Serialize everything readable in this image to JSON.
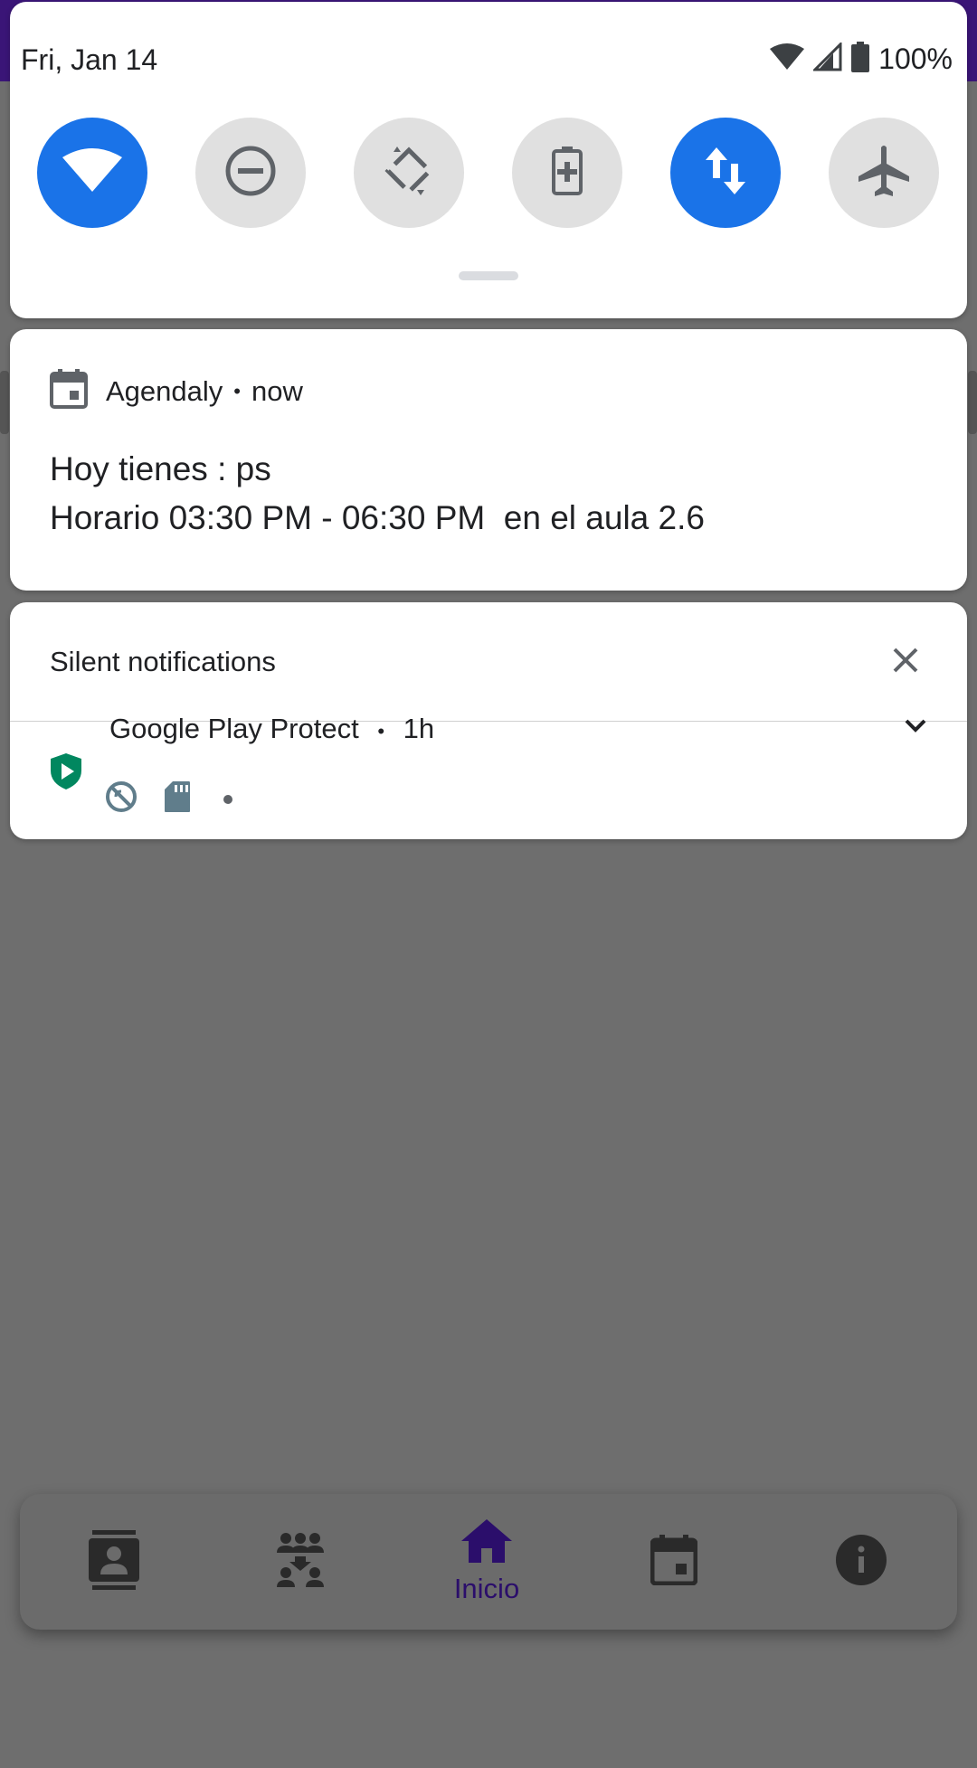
{
  "status_bar": {
    "date": "Fri, Jan 14",
    "battery_percent": "100%",
    "icons": [
      "wifi-icon",
      "cell-signal-icon",
      "battery-icon"
    ]
  },
  "quick_settings": {
    "tiles": [
      {
        "icon": "wifi-icon",
        "active": true
      },
      {
        "icon": "do-not-disturb-icon",
        "active": false
      },
      {
        "icon": "auto-rotate-icon",
        "active": false
      },
      {
        "icon": "battery-saver-icon",
        "active": false
      },
      {
        "icon": "mobile-data-icon",
        "active": true
      },
      {
        "icon": "airplane-mode-icon",
        "active": false
      }
    ],
    "colors": {
      "active": "#1a73e8",
      "inactive": "#e0e0e0"
    }
  },
  "notification": {
    "app": "Agendaly",
    "time": "now",
    "title": "Hoy tienes : ps",
    "text": "Horario 03:30 PM - 06:30 PM  en el aula 2.6",
    "icon": "calendar-icon"
  },
  "silent_notifications": {
    "title": "Silent notifications",
    "items": [
      {
        "app": "Google Play Protect",
        "time": "1h",
        "icons": [
          "play-protect-shield-icon",
          "sync-disabled-icon",
          "sd-card-icon"
        ]
      }
    ]
  },
  "bottom_nav": {
    "items": [
      {
        "icon": "contacts-icon",
        "label": ""
      },
      {
        "icon": "groups-icon",
        "label": ""
      },
      {
        "icon": "home-icon",
        "label": "Inicio",
        "active": true
      },
      {
        "icon": "event-icon",
        "label": ""
      },
      {
        "icon": "info-icon",
        "label": ""
      }
    ],
    "active_color": "#2b0e6b"
  }
}
